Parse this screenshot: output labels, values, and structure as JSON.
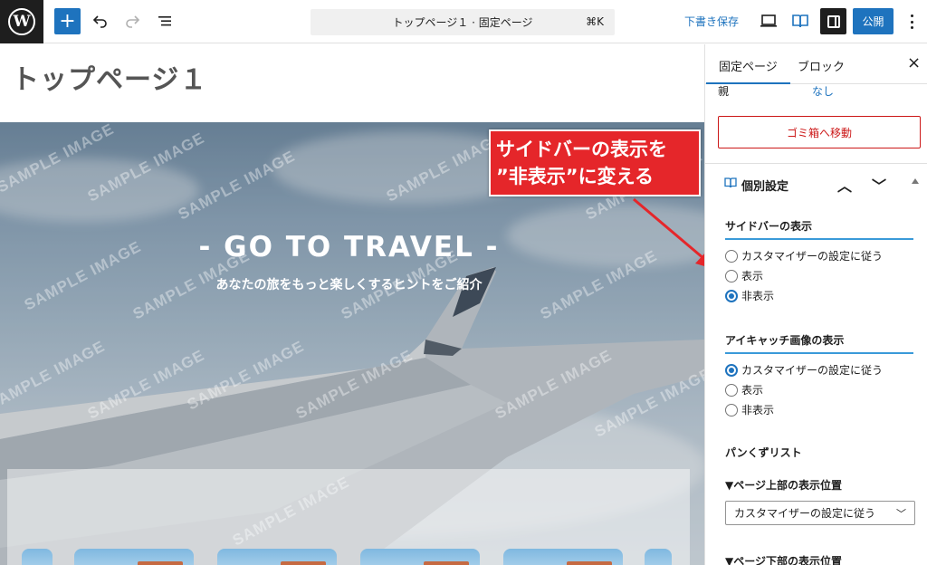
{
  "toolbar": {
    "logo_letter": "W",
    "add_symbol": "+",
    "document_title": "トップページ１ · 固定ページ",
    "command_shortcut": "⌘K",
    "save_draft_label": "下書き保存",
    "publish_label": "公開"
  },
  "editor": {
    "page_title": "トップページ１",
    "hero_title": "- GO TO TRAVEL -",
    "hero_subtitle": "あなたの旅をもっと楽しくするヒントをご紹介",
    "watermark_text": "SAMPLE IMAGE"
  },
  "annotation": {
    "line1": "サイドバーの表示を",
    "line2": "”非表示”に変える",
    "color": "#e5262a"
  },
  "sidebar": {
    "tabs": [
      {
        "label": "固定ページ",
        "active": true
      },
      {
        "label": "ブロック",
        "active": false
      }
    ],
    "close_symbol": "×",
    "parent_label": "親",
    "parent_value": "なし",
    "trash_label": "ゴミ箱へ移動",
    "panel_title": "個別設定",
    "sections": {
      "sidebar_display": {
        "title": "サイドバーの表示",
        "options": [
          "カスタマイザーの設定に従う",
          "表示",
          "非表示"
        ],
        "selected": "非表示"
      },
      "eyecatch_display": {
        "title": "アイキャッチ画像の表示",
        "options": [
          "カスタマイザーの設定に従う",
          "表示",
          "非表示"
        ],
        "selected": "カスタマイザーの設定に従う"
      },
      "breadcrumb": {
        "title": "パンくずリスト",
        "top_position_label": "▼ページ上部の表示位置",
        "top_position_value": "カスタマイザーの設定に従う",
        "bottom_position_label": "▼ページ下部の表示位置"
      }
    }
  },
  "colors": {
    "accent": "#1e73be",
    "danger": "#cc1818",
    "section_underline": "#3a9ad9"
  }
}
